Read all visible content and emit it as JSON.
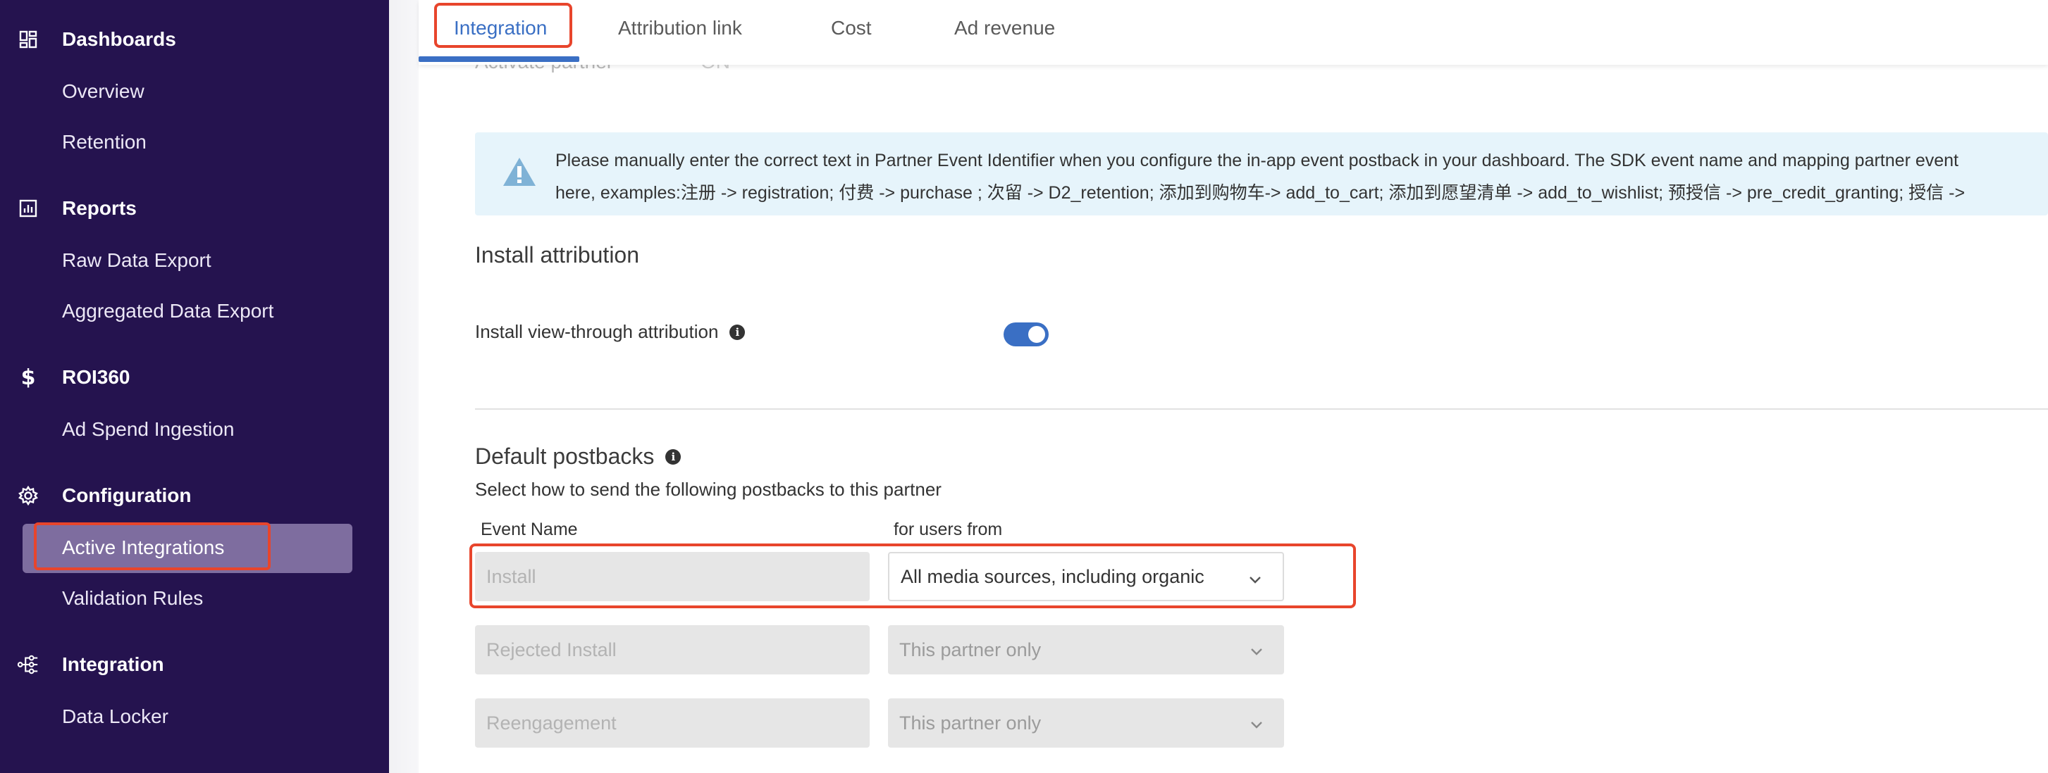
{
  "sidebar": {
    "sections": [
      {
        "label": "Dashboards",
        "icon": "dashboard-grid-icon",
        "items": [
          "Overview",
          "Retention"
        ]
      },
      {
        "label": "Reports",
        "icon": "bar-chart-icon",
        "items": [
          "Raw Data Export",
          "Aggregated Data Export"
        ]
      },
      {
        "label": "ROI360",
        "icon": "dollar-icon",
        "items": [
          "Ad Spend Ingestion"
        ]
      },
      {
        "label": "Configuration",
        "icon": "gear-icon",
        "items": [
          "Active Integrations",
          "Validation Rules"
        ]
      },
      {
        "label": "Integration",
        "icon": "integration-nodes-icon",
        "items": [
          "Data Locker"
        ]
      }
    ],
    "active_item": "Active Integrations"
  },
  "tabs": [
    "Integration",
    "Attribution link",
    "Cost",
    "Ad revenue"
  ],
  "active_tab": "Integration",
  "partially_visible": {
    "label": "Activate partner",
    "value": "ON"
  },
  "alert": {
    "line1": "Please manually enter the correct text in Partner Event Identifier when you configure the in-app event postback in your dashboard. The SDK event name and mapping partner event",
    "line2": "here, examples:注册 -> registration; 付费 -> purchase ; 次留 -> D2_retention; 添加到购物车-> add_to_cart; 添加到愿望清单 -> add_to_wishlist; 预授信 -> pre_credit_granting; 授信 ->"
  },
  "install_attribution": {
    "title": "Install attribution",
    "view_through_label": "Install view-through attribution",
    "view_through_enabled": true
  },
  "default_postbacks": {
    "title": "Default postbacks",
    "subtitle": "Select how to send the following postbacks to this partner",
    "col_event": "Event Name",
    "col_users": "for users from",
    "rows": [
      {
        "event": "Install",
        "users": "All media sources, including organic",
        "enabled": true
      },
      {
        "event": "Rejected Install",
        "users": "This partner only",
        "enabled": false
      },
      {
        "event": "Reengagement",
        "users": "This partner only",
        "enabled": false
      }
    ]
  },
  "colors": {
    "sidebar_bg": "#25134f",
    "active_item_bg": "#7e6d9f",
    "accent": "#3a6fc4",
    "highlight": "#e8452c",
    "alert_bg": "#e6f4fb"
  }
}
